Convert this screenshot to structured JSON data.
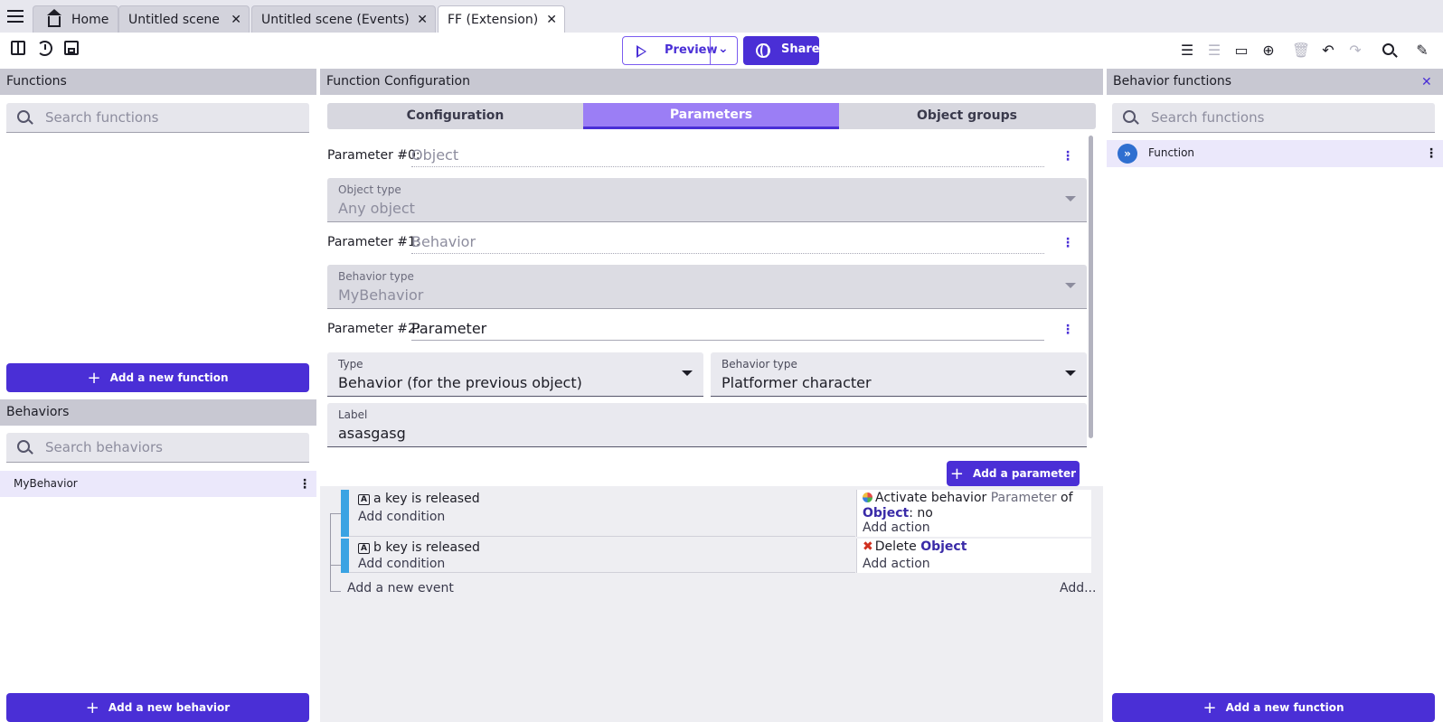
{
  "tabs": [
    {
      "label": "Home",
      "closable": false
    },
    {
      "label": "Untitled scene",
      "closable": true
    },
    {
      "label": "Untitled scene (Events)",
      "closable": true
    },
    {
      "label": "FF (Extension)",
      "closable": true,
      "active": true
    }
  ],
  "toolbar": {
    "preview_label": "Preview",
    "share_label": "Share"
  },
  "left": {
    "functions_title": "Functions",
    "functions_search_placeholder": "Search functions",
    "add_function_label": "Add a new function",
    "behaviors_title": "Behaviors",
    "behaviors_search_placeholder": "Search behaviors",
    "behaviors": [
      "MyBehavior"
    ],
    "add_behavior_label": "Add a new behavior"
  },
  "center": {
    "title": "Function Configuration",
    "tabs": [
      "Configuration",
      "Parameters",
      "Object groups"
    ],
    "active_tab": "Parameters",
    "params": [
      {
        "label": "Parameter #0:",
        "name": "Object",
        "type_label": "Object type",
        "type_value": "Any object"
      },
      {
        "label": "Parameter #1:",
        "name": "Behavior",
        "type_label": "Behavior type",
        "type_value": "MyBehavior"
      },
      {
        "label": "Parameter #2:",
        "name": "Parameter",
        "type_label": "Type",
        "type_value": "Behavior (for the previous object)",
        "behavior_type_label": "Behavior type",
        "behavior_type_value": "Platformer character",
        "field_label": "Label",
        "field_value": "asasgasg"
      }
    ],
    "add_parameter_label": "Add a parameter"
  },
  "events": [
    {
      "key": "a",
      "condition": "key is released",
      "add_condition": "Add condition",
      "action_prefix": "Activate behavior",
      "action_param": "Parameter",
      "action_of": "of",
      "action_object": "Object",
      "action_suffix": ": no",
      "add_action": "Add action"
    },
    {
      "key": "b",
      "condition": "key is released",
      "add_condition": "Add condition",
      "action_prefix": "Delete",
      "action_object": "Object",
      "add_action": "Add action"
    }
  ],
  "events_footer": {
    "add_event": "Add a new event",
    "add_more": "Add..."
  },
  "right": {
    "title": "Behavior functions",
    "search_placeholder": "Search functions",
    "functions": [
      "Function"
    ],
    "add_function_label": "Add a new function"
  },
  "colors": {
    "accent": "#4a2fd6",
    "active_tab": "#9b7ef5",
    "event_bar": "#3aa3e3"
  }
}
